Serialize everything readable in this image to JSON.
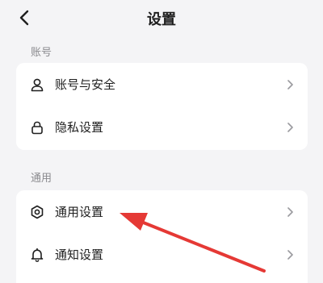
{
  "header": {
    "title": "设置"
  },
  "sections": [
    {
      "label": "账号",
      "items": [
        {
          "label": "账号与安全",
          "icon": "person-icon"
        },
        {
          "label": "隐私设置",
          "icon": "lock-icon"
        }
      ]
    },
    {
      "label": "通用",
      "items": [
        {
          "label": "通用设置",
          "icon": "gear-icon"
        },
        {
          "label": "通知设置",
          "icon": "bell-icon"
        }
      ]
    }
  ],
  "colors": {
    "background": "#f4f4f6",
    "card": "#ffffff",
    "annotation_arrow": "#e53935",
    "secondary_text": "#8a8a8e",
    "chevron": "#9a9a9e"
  },
  "annotation": {
    "type": "arrow",
    "points_to": "通用设置"
  }
}
